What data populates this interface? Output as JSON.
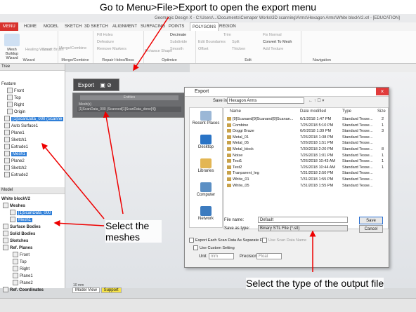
{
  "caption_top": "Go to Menu>File>Export to open the export menu",
  "annotations": {
    "select_meshes": "Select the meshes",
    "select_type": "Select the type of the output file"
  },
  "app": {
    "title": "Geomagic Design X - C:\\Users\\...\\Documents\\Cemaper Works\\3D scanning\\Arms\\Hexagon Arms\\White blockV2.xrl - [EDUCATION]",
    "menu_tabs": [
      "MENU",
      "HOME",
      "MODEL",
      "SKETCH",
      "3D SKETCH",
      "ALIGNMENT",
      "SURFACING",
      "POINTS",
      "POLYGONS",
      "REGION"
    ],
    "active_tab": "POLYGONS"
  },
  "ribbon": {
    "groups": [
      "Wizard",
      "Merge/Combine",
      "Repair Holes/Boss",
      "Optimize",
      "Edit",
      "Navigation"
    ],
    "wizard": {
      "mesh_buildup": "Mesh Buildup Wizard",
      "healing": "Healing Wizard",
      "smart_brush": "Smart Brush"
    },
    "merge": {
      "merge_combine": "Merge/Combine"
    },
    "repair": {
      "fill_holes": "Fill Holes",
      "defeature": "Defeature",
      "remove_markers": "Remove Markers"
    },
    "optimize": {
      "decimate": "Decimate",
      "subdivide": "Subdivide",
      "smooth": "Smooth",
      "enhance_shape": "Enhance Shape",
      "global_remesh": "Global Remesh"
    },
    "edit": {
      "trim": "Trim",
      "edit_boundaries": "Edit Boundaries",
      "offset": "Offset",
      "split": "Split",
      "thicken": "Thicken",
      "convert_to_mesh": "Convert To Mesh",
      "fix_normal": "Fix Normal",
      "add_texture": "Add Texture"
    }
  },
  "tree": {
    "header": "Tree",
    "feature_label": "Feature",
    "items": [
      "Front",
      "Top",
      "Right",
      "Origin",
      "[1]ScanData_000 (Scanne",
      "Auto Surface1",
      "Plane1",
      "Sketch1",
      "Extrude1",
      "Mesh1",
      "Plane2",
      "Sketch2",
      "Extrude2"
    ],
    "model_label": "Model",
    "model_name": "White blockV2",
    "model_items": [
      "Meshes",
      "[1]ScanData_000",
      "Mesh1",
      "Surface Bodies",
      "Solid Bodies",
      "Sketches",
      "Ref. Planes",
      "Front",
      "Top",
      "Right",
      "Plane1",
      "Plane2",
      "Ref. Coordinates"
    ]
  },
  "export_panel": {
    "title": "Export",
    "entities_label": "Entities",
    "meshes_label": "Mesh(s)",
    "meshes_value": "[1]ScanData_000 (Scanned[1]ScanData_done[4])"
  },
  "dialog": {
    "title": "Export",
    "save_in_label": "Save in:",
    "save_in_value": "Hexagon Arms",
    "places": [
      "Recent Places",
      "Desktop",
      "Libraries",
      "Computer",
      "Network"
    ],
    "columns": [
      "Name",
      "Date modified",
      "Type",
      "Size"
    ],
    "files": [
      {
        "name": "[9]Scanand[9]Scanand[9]Scanan...",
        "date": "6/1/2018 1:47 PM",
        "type": "Standard Tesse...",
        "size": "2"
      },
      {
        "name": "Combine",
        "date": "7/25/2018 5:10 PM",
        "type": "Standard Tesse...",
        "size": "1"
      },
      {
        "name": "Doggi Braze",
        "date": "6/6/2018 1:39 PM",
        "type": "Standard Tesse...",
        "size": "3"
      },
      {
        "name": "Metal_01",
        "date": "7/26/2018 1:38 PM",
        "type": "Standard Tesse...",
        "size": ""
      },
      {
        "name": "Metal_05",
        "date": "7/26/2018 1:51 PM",
        "type": "Standard Tesse...",
        "size": ""
      },
      {
        "name": "Metal_block",
        "date": "7/30/2018 2:20 PM",
        "type": "Standard Tesse...",
        "size": "8"
      },
      {
        "name": "Noise",
        "date": "7/26/2018 1:01 PM",
        "type": "Standard Tesse...",
        "size": "1"
      },
      {
        "name": "Test1",
        "date": "7/26/2018 10:43 AM",
        "type": "Standard Tesse...",
        "size": "1"
      },
      {
        "name": "Test2",
        "date": "7/26/2018 10:44 AM",
        "type": "Standard Tesse...",
        "size": "1"
      },
      {
        "name": "Tranparent_leg",
        "date": "7/31/2018 2:50 PM",
        "type": "Standard Tesse...",
        "size": ""
      },
      {
        "name": "White_01",
        "date": "7/31/2018 1:55 PM",
        "type": "Standard Tesse...",
        "size": ""
      },
      {
        "name": "White_05",
        "date": "7/31/2018 1:55 PM",
        "type": "Standard Tesse...",
        "size": ""
      }
    ],
    "file_name_label": "File name:",
    "file_name_value": "Default",
    "save_type_label": "Save as type:",
    "save_type_value": "Binary STL File (*.stl)",
    "save_button": "Save",
    "cancel_button": "Cancel",
    "export_each_label": "Export Each Scan Data As Separate File",
    "use_scan_data_name": "Use Scan Data Name",
    "use_custom_setting": "Use Custom Setting",
    "unit_label": "Unit",
    "unit_value": "mm",
    "precision_label": "Precision",
    "precision_value": "Float"
  },
  "bottom_tabs": [
    "Model View",
    "Support"
  ],
  "scale_label": "10 mm",
  "colors": {
    "menu_red": "#d8322d",
    "selection_blue": "#2f7fd8",
    "dialog_red_close": "#e13b3b"
  }
}
